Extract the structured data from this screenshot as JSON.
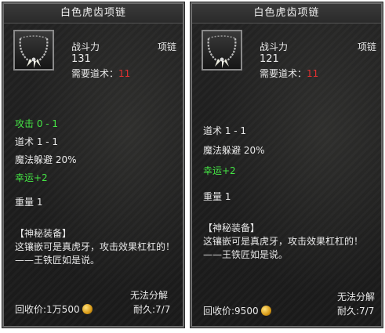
{
  "left": {
    "title": "白色虎齿项链",
    "power_label": "战斗力",
    "power_value": "131",
    "req_label": "需要道术：",
    "req_value": "11",
    "item_type": "项链",
    "stats": [
      {
        "text": "攻击 0 - 1",
        "color": "green"
      },
      {
        "text": "道术 1 - 1",
        "color": "white"
      },
      {
        "text": "魔法躲避 20%",
        "color": "white"
      },
      {
        "text": "幸运+2",
        "color": "green"
      },
      {
        "text": "重量 1",
        "color": "white"
      }
    ],
    "mystery_head": "【神秘装备】",
    "mystery_text": "这镶嵌可是真虎牙，攻击效果杠杠的！——王铁匠如是说。",
    "unbreakable": "无法分解",
    "recycle_label": "回收价:",
    "recycle_value": "1万500",
    "durability": "耐久:7/7"
  },
  "right": {
    "title": "白色虎齿项链",
    "power_label": "战斗力",
    "power_value": "121",
    "req_label": "需要道术：",
    "req_value": "11",
    "item_type": "项链",
    "stats": [
      {
        "text": "道术 1 - 1",
        "color": "white"
      },
      {
        "text": "魔法躲避 20%",
        "color": "white"
      },
      {
        "text": "幸运+2",
        "color": "green"
      },
      {
        "text": "重量 1",
        "color": "white"
      }
    ],
    "mystery_head": "【神秘装备】",
    "mystery_text": "这镶嵌可是真虎牙，攻击效果杠杠的！——王铁匠如是说。",
    "unbreakable": "无法分解",
    "recycle_label": "回收价:",
    "recycle_value": "9500",
    "durability": "耐久:7/7"
  },
  "colors": {
    "green": "#45e645",
    "red": "#e03030",
    "text": "#e8e8e8"
  },
  "icons": [
    "tiger-tooth-necklace-icon",
    "gold-coin-icon"
  ]
}
